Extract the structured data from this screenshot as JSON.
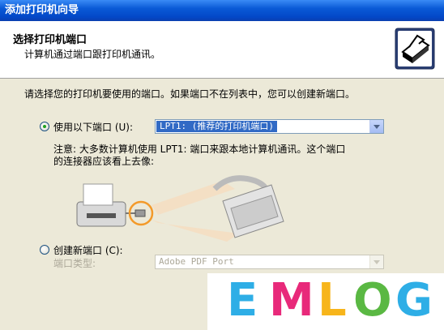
{
  "window": {
    "title": "添加打印机向导"
  },
  "header": {
    "title": "选择打印机端口",
    "subtitle": "计算机通过端口跟打印机通讯。",
    "icon": "printer-icon"
  },
  "intro_text": "请选择您的打印机要使用的端口。如果端口不在列表中，您可以创建新端口。",
  "use_port": {
    "label": "使用以下端口 (U):",
    "checked": true,
    "selected_value": "LPT1: (推荐的打印机端口)",
    "note_line1": "注意: 大多数计算机使用 LPT1: 端口来跟本地计算机通讯。这个端口",
    "note_line2": "的连接器应该看上去像:"
  },
  "new_port": {
    "label": "创建新端口 (C):",
    "checked": false,
    "type_label": "端口类型:",
    "type_value": "Adobe PDF Port"
  },
  "watermark": {
    "letters": [
      "E",
      "M",
      "L",
      "O",
      "G"
    ],
    "colors": [
      "#2eaee6",
      "#e8297a",
      "#f7b51b",
      "#5ab843",
      "#2eaee6"
    ]
  }
}
